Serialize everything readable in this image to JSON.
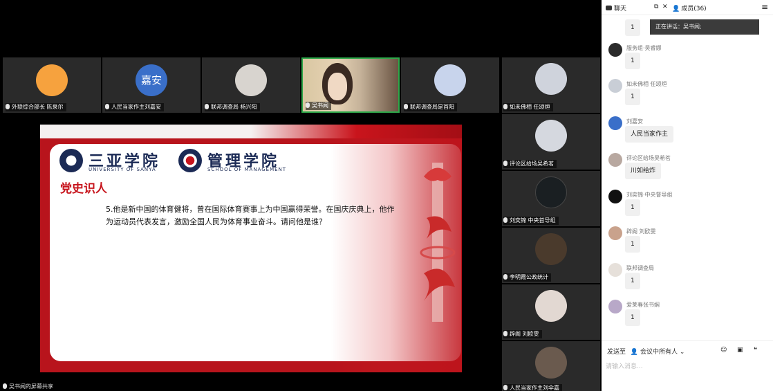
{
  "top_tiles": [
    {
      "name": "外联综合部长 陈泉尔",
      "avatar_color": "#f6a23e"
    },
    {
      "name": "人民当家作主刘嘉安",
      "avatar_text": "嘉安",
      "avatar_color": "#3a6fc9"
    },
    {
      "name": "联邦调查局 杨兴阳",
      "avatar_color": "#d8d4cf"
    },
    {
      "name": "吴书闻",
      "active": true
    },
    {
      "name": "联邦调查局是首阳",
      "avatar_color": "#c8d4ec"
    }
  ],
  "right_tiles": [
    {
      "name": "如未佛相 任颂烜",
      "avatar_color": "#cfd3dc"
    },
    {
      "name": "评论区给场吴希茗",
      "avatar_color": "#d5d8df"
    },
    {
      "name": "刘奕锦 中央首导组",
      "avatar_color": "#1a1f22"
    },
    {
      "name": "李明霞公政统计",
      "avatar_color": "#4a3a2c"
    },
    {
      "name": "辟阁 刘欧雯",
      "avatar_color": "#e2d8d2"
    },
    {
      "name": "人民当家作主刘伞嘉",
      "avatar_color": "#6a5a4e"
    }
  ],
  "slide": {
    "school_cn": "三亚学院",
    "school_en": "UNIVERSITY OF SANYA",
    "dept_cn": "管理学院",
    "dept_en": "SCHOOL OF MANAGEMENT",
    "title": "党史识人",
    "question": "5.他是新中国的体育健将，曾在国际体育赛事上为中国赢得荣誉。在国庆庆典上，他作为运动员代表发言，激励全国人民为体育事业奋斗。请问他是谁？"
  },
  "share_label": "吴书闻的屏幕共享",
  "chat": {
    "tab_chat": "聊天",
    "tab_members": "成员(36)",
    "notice": "正在讲话：吴书闻;",
    "messages": [
      {
        "name": "",
        "text": "1",
        "avatar_color": "#444"
      },
      {
        "name": "服务组·吴睿娜",
        "text": "1",
        "avatar_color": "#2b2b2b"
      },
      {
        "name": "如未佛相 任颂烜",
        "text": "1",
        "avatar_color": "#c9ced6"
      },
      {
        "name": "刘嘉安",
        "text": "人民当家作主",
        "avatar_color": "#3a6fc9"
      },
      {
        "name": "评论区给场吴希茗",
        "text": "川如给炸",
        "avatar_color": "#b8a8a0"
      },
      {
        "name": "刘奕锦·中央督导组",
        "text": "1",
        "avatar_color": "#111"
      },
      {
        "name": "辟阁 刘欧雯",
        "text": "1",
        "avatar_color": "#c9a28c"
      },
      {
        "name": "联邦调查局",
        "text": "1",
        "avatar_color": "#e6e0da"
      },
      {
        "name": "爱莱春张书娴",
        "text": "1",
        "avatar_color": "#b8a8c8"
      }
    ],
    "send_to_label": "发送至",
    "send_to_value": "会议中所有人",
    "input_placeholder": "请输入消息..."
  }
}
